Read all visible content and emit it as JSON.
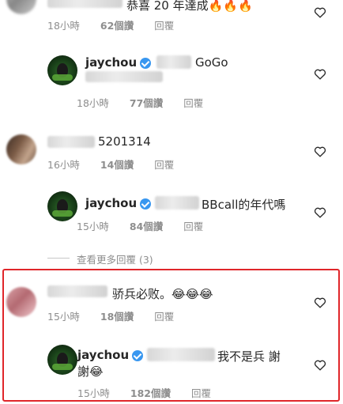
{
  "comments": [
    {
      "text": "恭喜 20 年達成🔥🔥🔥",
      "time": "18小時",
      "likes": "62個讚",
      "reply": "回覆"
    },
    {
      "user": "jaychou",
      "text": "GoGo",
      "time": "18小時",
      "likes": "77個讚",
      "reply": "回覆"
    },
    {
      "text": "5201314",
      "time": "16小時",
      "likes": "14個讚",
      "reply": "回覆"
    },
    {
      "user": "jaychou",
      "text": "BBcall的年代嗎",
      "time": "15小時",
      "likes": "84個讚",
      "reply": "回覆"
    },
    {
      "text": "骄兵必败。😂😂😂",
      "time": "15小時",
      "likes": "18個讚",
      "reply": "回覆"
    },
    {
      "user": "jaychou",
      "text_line1": "我不是兵 謝",
      "text_line2": "謝😂",
      "time": "15小時",
      "likes": "182個讚",
      "reply": "回覆"
    }
  ],
  "view_more_replies": "查看更多回覆 (3)",
  "icons": {
    "like": "heart-outline-icon",
    "verified": "verified-badge-icon"
  },
  "colors": {
    "verified": "#3897f0",
    "highlight_border": "#e0262a"
  }
}
